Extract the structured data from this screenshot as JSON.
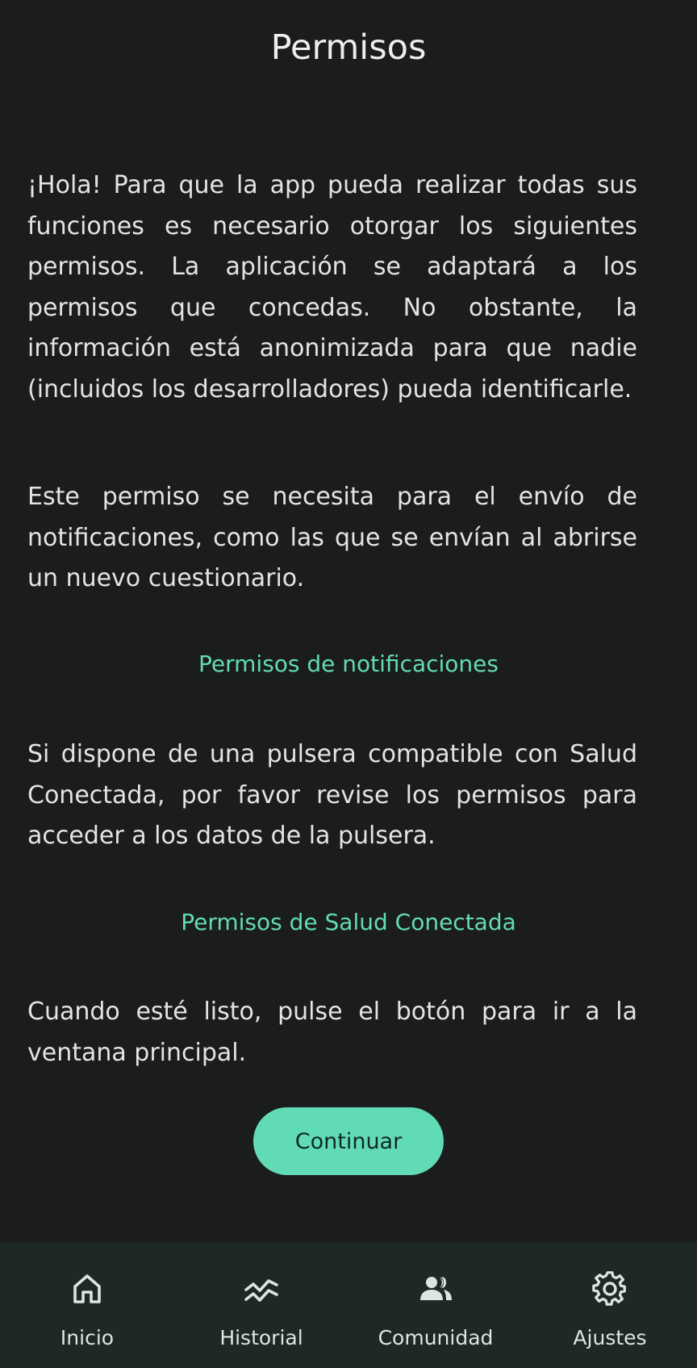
{
  "header": {
    "title": "Permisos"
  },
  "content": {
    "intro_text": "¡Hola! Para que la app pueda realizar todas sus funciones es necesario otorgar los siguientes permisos. La aplicación se adaptará a los permisos que concedas. No obstante, la información está anonimizada para que nadie (incluidos los desarrolladores) pueda identificarle.",
    "notifications_text": "Este permiso se necesita para el envío de notificaciones, como las que se envían al abrirse un nuevo cuestionario.",
    "notifications_link": "Permisos de notificaciones",
    "salud_text": "Si dispone de una pulsera compatible con Salud Conectada, por favor revise los permisos para acceder a los datos de la pulsera.",
    "salud_link": "Permisos de Salud Conectada",
    "ready_text": "Cuando esté listo, pulse el botón para ir a la ventana principal.",
    "continue_label": "Continuar"
  },
  "nav": {
    "items": [
      {
        "label": "Inicio",
        "icon": "home-icon"
      },
      {
        "label": "Historial",
        "icon": "history-chart-icon"
      },
      {
        "label": "Comunidad",
        "icon": "community-icon"
      },
      {
        "label": "Ajustes",
        "icon": "gear-icon"
      }
    ]
  },
  "colors": {
    "background": "#1b1c1c",
    "accent": "#61dbb5",
    "nav_background": "#1e2827",
    "text": "#e4e4e2"
  }
}
